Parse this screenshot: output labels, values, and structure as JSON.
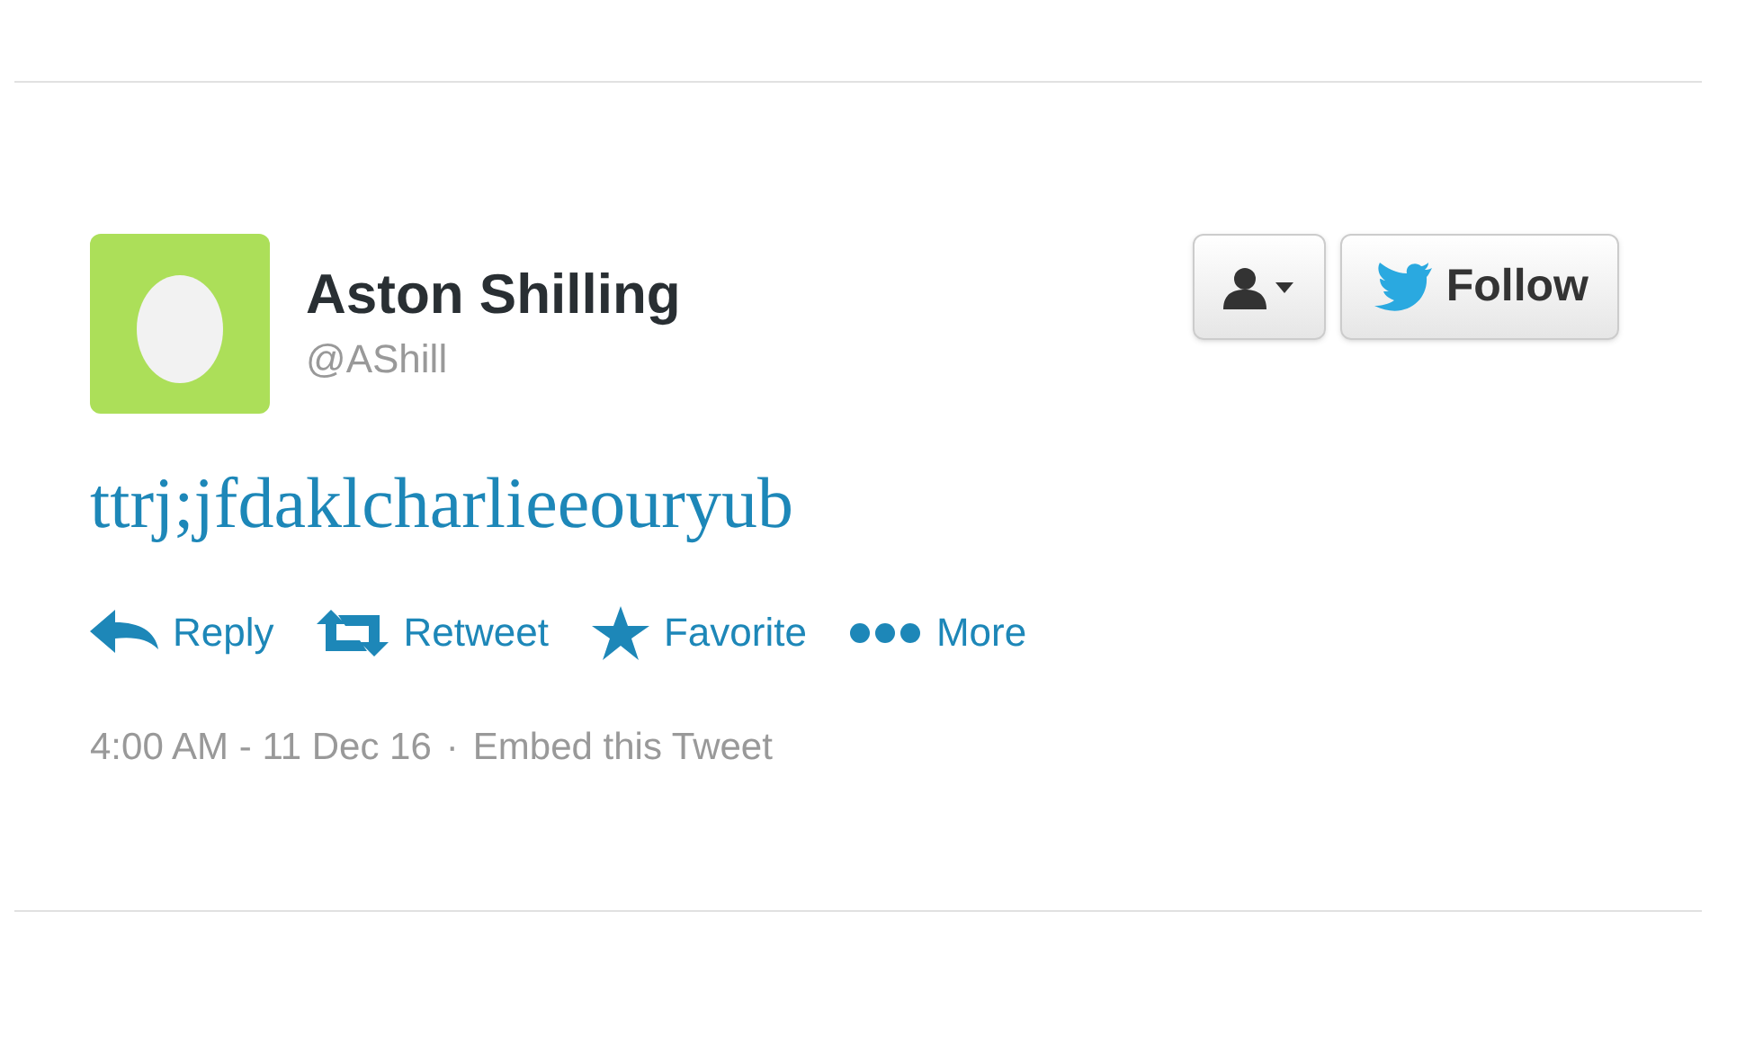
{
  "user": {
    "name": "Aston Shilling",
    "handle": "@AShill"
  },
  "buttons": [
    {
      "kind": "user-menu"
    },
    {
      "kind": "follow",
      "label": "Follow"
    }
  ],
  "tweet": {
    "text": "ttrj;jfdaklcharlieeouryub"
  },
  "actions": [
    {
      "kind": "reply",
      "label": "Reply"
    },
    {
      "kind": "retweet",
      "label": "Retweet"
    },
    {
      "kind": "favorite",
      "label": "Favorite"
    },
    {
      "kind": "more",
      "label": "More"
    }
  ],
  "footer": {
    "time": "4:00 AM - 11 Dec 16",
    "separator": "·",
    "embed": "Embed this Tweet"
  }
}
